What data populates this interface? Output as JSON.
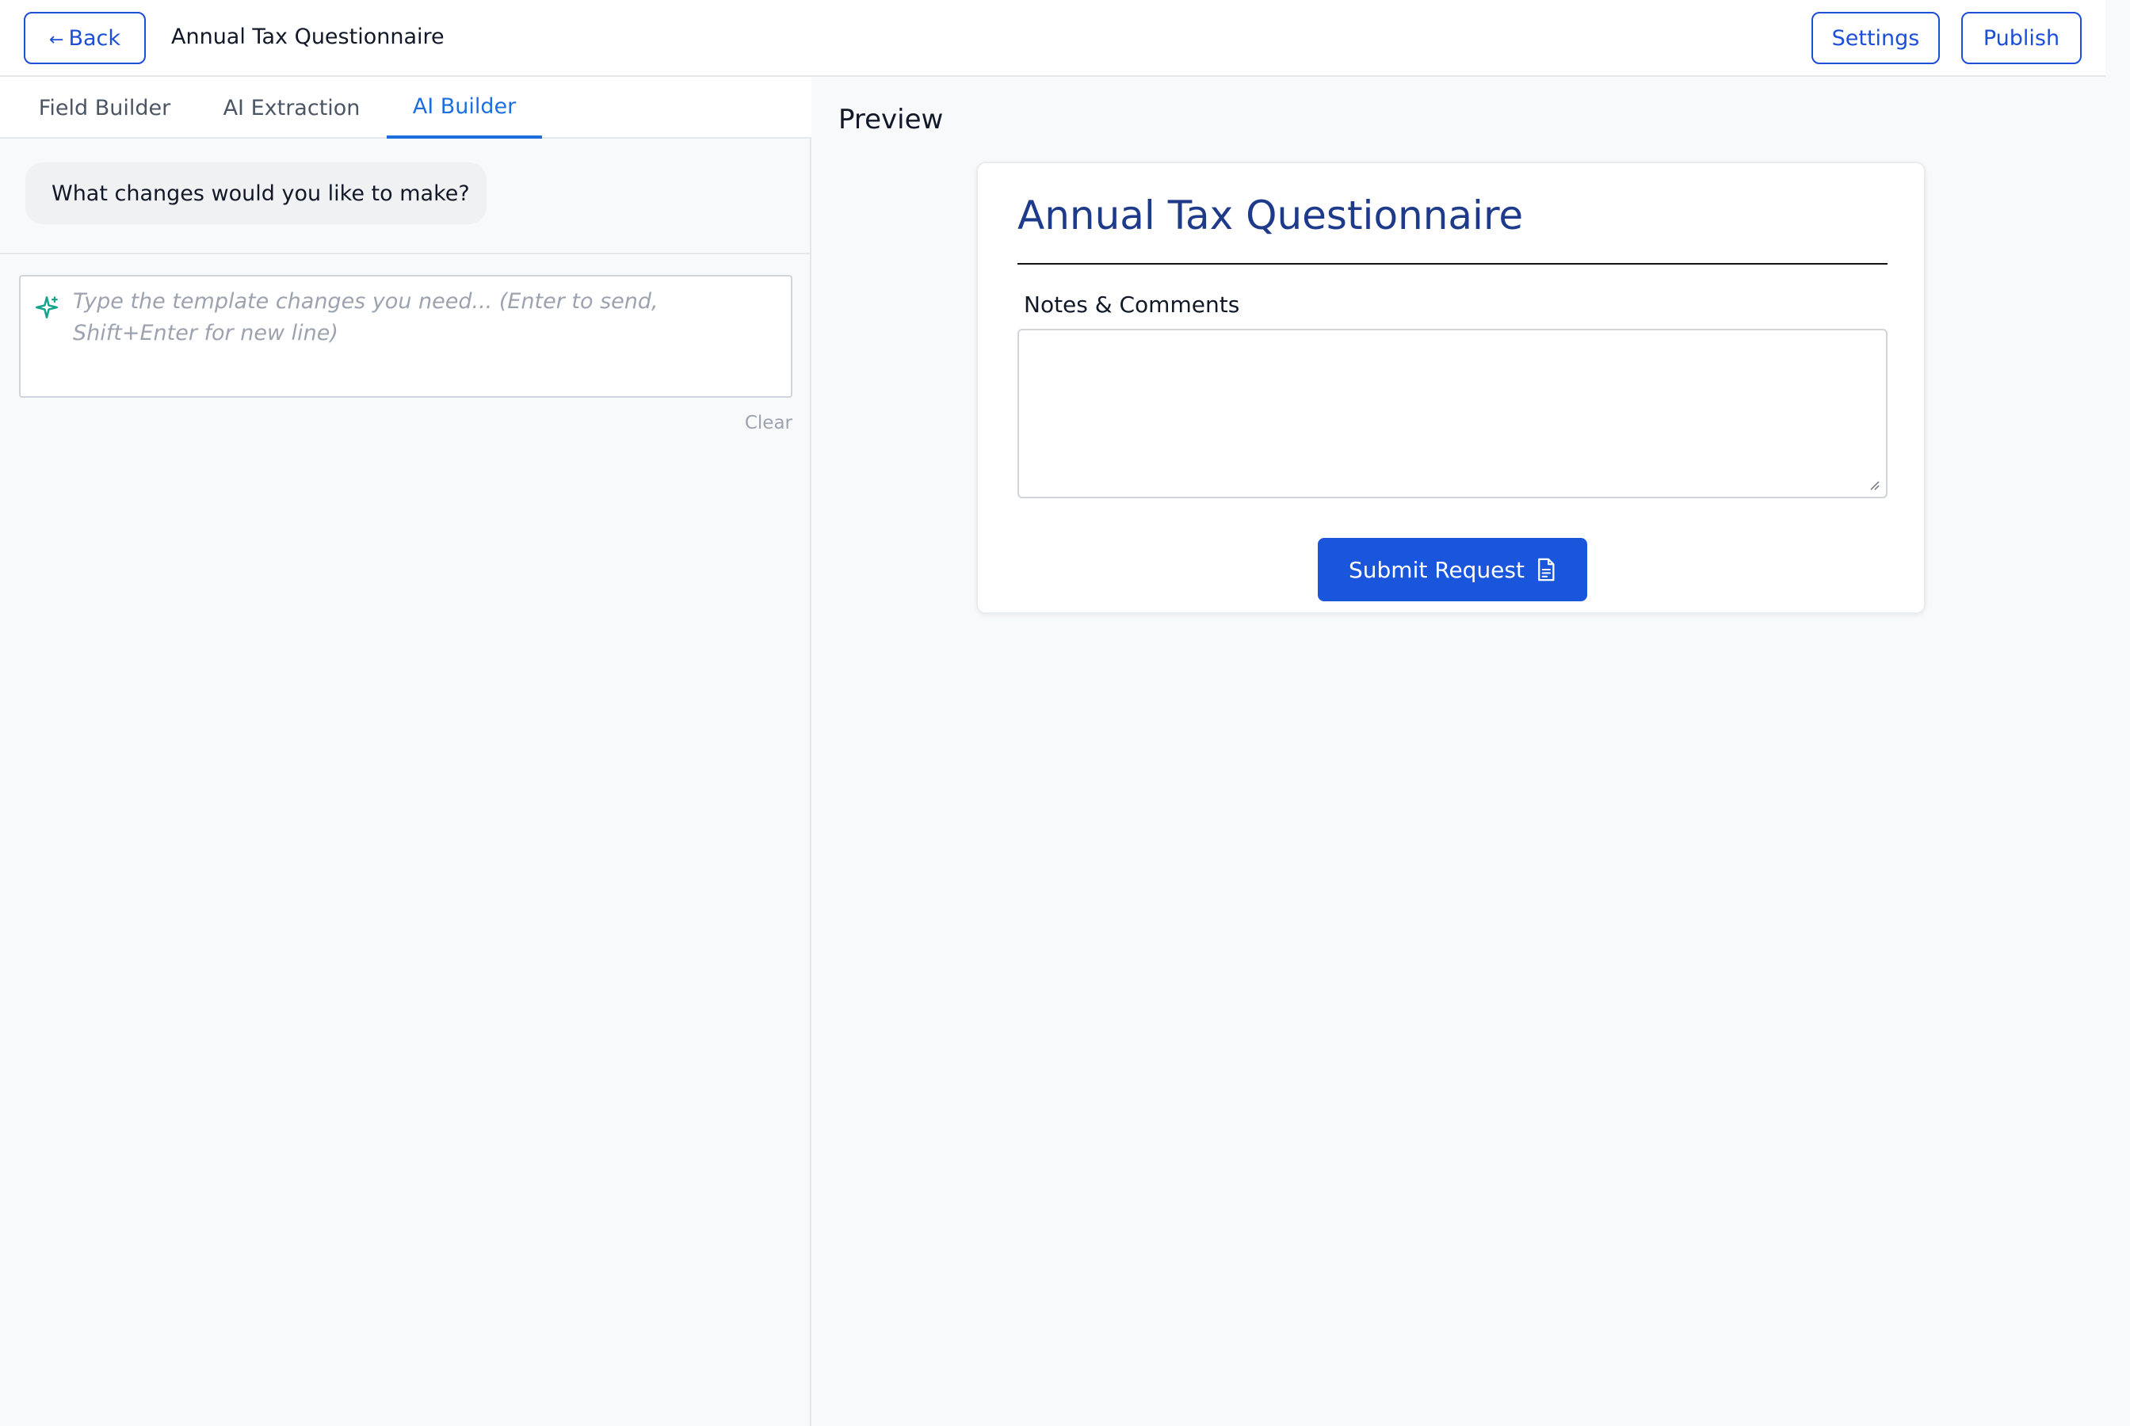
{
  "header": {
    "back_arrow": "←",
    "back_label": "Back",
    "title": "Annual Tax Questionnaire",
    "settings_label": "Settings",
    "publish_label": "Publish"
  },
  "tabs": [
    {
      "label": "Field Builder",
      "active": false
    },
    {
      "label": "AI Extraction",
      "active": false
    },
    {
      "label": "AI Builder",
      "active": true
    }
  ],
  "chat": {
    "assistant_message": "What changes would you like to make?",
    "input_placeholder": "Type the template changes you need... (Enter to send, Shift+Enter for new line)",
    "input_icon": "sparkle-icon",
    "clear_label": "Clear"
  },
  "preview": {
    "label": "Preview",
    "form_title": "Annual Tax Questionnaire",
    "field_label": "Notes & Comments",
    "field_value": "",
    "submit_label": "Submit Request",
    "submit_icon": "document-icon"
  },
  "colors": {
    "accent": "#1d4ed8",
    "active_tab": "#1d6fe0",
    "submit_bg": "#1a56db",
    "title_color": "#1e3a8a",
    "sparkle": "#14a38b"
  }
}
